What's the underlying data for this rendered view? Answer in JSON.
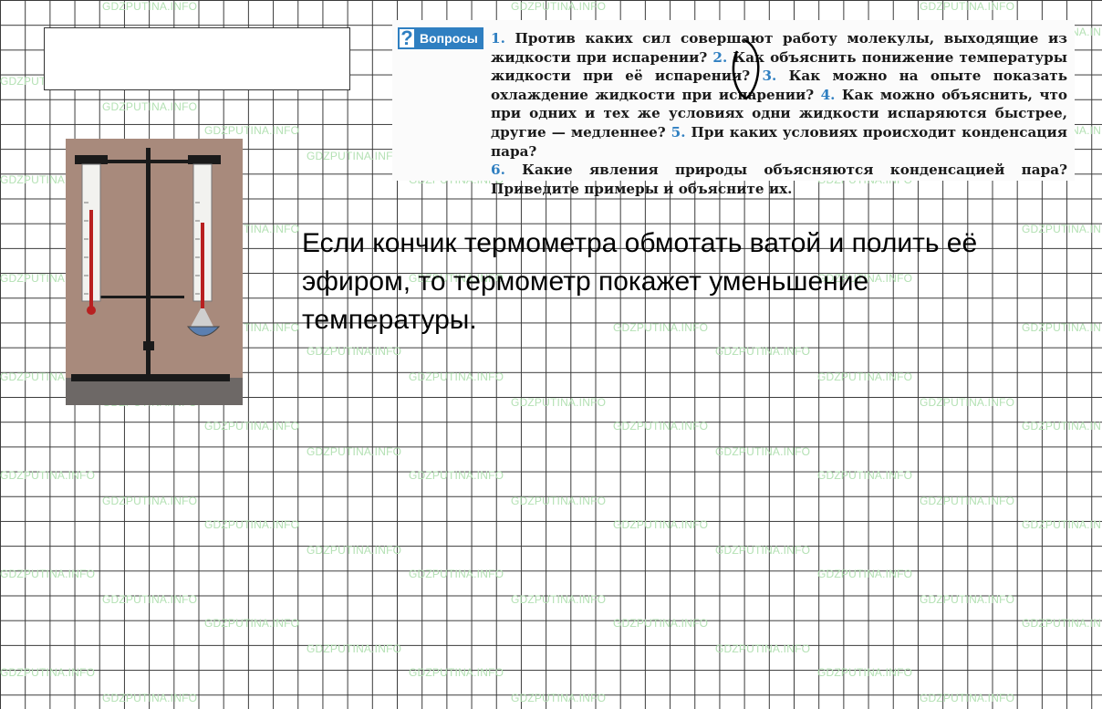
{
  "watermark": "GDZPUTINA.INFO",
  "questions": {
    "header_label": "Вопросы",
    "header_icon": "question-mark-icon",
    "items": [
      {
        "num": "1.",
        "text": " Против каких сил совершают работу молекулы, выходящие из жидкости при испарении? "
      },
      {
        "num": "2.",
        "text": " Как объяснить понижение температуры жидкости при её испарении? "
      },
      {
        "num": "3.",
        "text": " Как можно на опыте показать охлаждение жидкости при испарении? "
      },
      {
        "num": "4.",
        "text": " Как можно объяснить, что при одних и тех же условиях одни жидкости испаряются быстрее, другие — медленнее? "
      },
      {
        "num": "5.",
        "text": " При каких условиях происходит конденсация пара? "
      },
      {
        "num": "6.",
        "text": " Какие явления природы объясняются конденсацией пара? Приведите примеры и объясните их."
      }
    ],
    "accent_color": "#2f7fc1"
  },
  "answer": {
    "text": "Если кончик термометра обмотать ватой и полить её эфиром, то термометр покажет уменьшение температуры."
  }
}
